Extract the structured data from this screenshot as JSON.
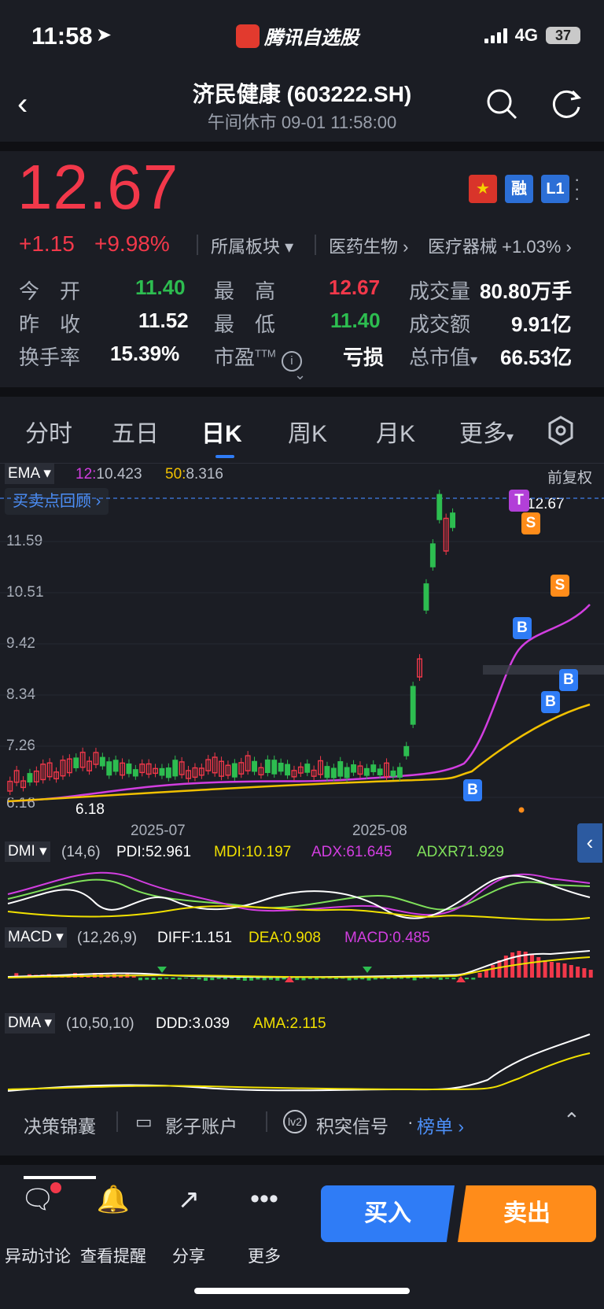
{
  "status_bar": {
    "time": "11:58",
    "app_name": "腾讯自选股",
    "network": "4G",
    "battery": "37"
  },
  "header": {
    "title": "济民健康 (603222.SH)",
    "subtitle": "午间休市   09-01 11:58:00"
  },
  "quote": {
    "price": "12.67",
    "change": "+1.15",
    "change_pct": "+9.98%",
    "sector_label": "所属板块",
    "sector_1": "医药生物",
    "sector_2": "医疗器械",
    "sector_2_pct": "+1.03%",
    "badges": [
      "融",
      "L1"
    ],
    "stats": {
      "open_label": "今　开",
      "open": "11.40",
      "high_label": "最　高",
      "high": "12.67",
      "volume_label": "成交量",
      "volume": "80.80万手",
      "prev_label": "昨　收",
      "prev": "11.52",
      "low_label": "最　低",
      "low": "11.40",
      "amount_label": "成交额",
      "amount": "9.91亿",
      "turnover_label": "换手率",
      "turnover": "15.39%",
      "pe_label": "市盈",
      "pe_sup": "TTM",
      "pe": "亏损",
      "mcap_label": "总市值",
      "mcap": "66.53亿"
    }
  },
  "tabs": [
    "分时",
    "五日",
    "日K",
    "周K",
    "月K",
    "更多"
  ],
  "active_tab": "日K",
  "chart": {
    "indicator": "EMA",
    "ema12_label": "12:",
    "ema12": "10.423",
    "ema50_label": "50:",
    "ema50": "8.316",
    "adjust": "前复权",
    "review_button": "买卖点回顾",
    "price_ticks": [
      "11.59",
      "10.51",
      "9.42",
      "8.34",
      "7.26",
      "6.16"
    ],
    "date_ticks": [
      "2025-07",
      "2025-08"
    ],
    "high_label": "12.67",
    "low_label": "6.18",
    "signals": [
      "T",
      "S",
      "S",
      "B",
      "B",
      "B",
      "B"
    ]
  },
  "chart_data": {
    "type": "line",
    "title": "",
    "xlabel": "",
    "ylabel": "",
    "x": [
      "2025-07",
      "2025-08"
    ],
    "ylim": [
      6.16,
      12.67
    ],
    "series": [
      {
        "name": "EMA12",
        "values": [
          10.423
        ]
      },
      {
        "name": "EMA50",
        "values": [
          8.316
        ]
      }
    ]
  },
  "dmi": {
    "label": "DMI",
    "params": "(14,6)",
    "pdi_label": "PDI:",
    "pdi": "52.961",
    "mdi_label": "MDI:",
    "mdi": "10.197",
    "adx_label": "ADX:",
    "adx": "61.645",
    "adxr_label": "ADXR",
    "adxr": "71.929"
  },
  "macd": {
    "label": "MACD",
    "params": "(12,26,9)",
    "diff_label": "DIFF:",
    "diff": "1.151",
    "dea_label": "DEA:",
    "dea": "0.908",
    "macd_label": "MACD:",
    "macd": "0.485"
  },
  "dma": {
    "label": "DMA",
    "params": "(10,50,10)",
    "ddd_label": "DDD:",
    "ddd": "3.039",
    "ama_label": "AMA:",
    "ama": "2.115"
  },
  "links": {
    "decision": "决策锦囊",
    "shadow": "影子账户",
    "signal": "积突信号",
    "dot": "·",
    "rank": "榜单"
  },
  "nav": {
    "discuss": "异动讨论",
    "alert": "查看提醒",
    "share": "分享",
    "more": "更多"
  },
  "actions": {
    "buy": "买入",
    "sell": "卖出"
  },
  "colors": {
    "up": "#f2384a",
    "down": "#2dbd50",
    "ema12": "#d23ee0",
    "ema50": "#f0c000",
    "buy": "#2f7cf6",
    "sell": "#ff8c1a"
  }
}
